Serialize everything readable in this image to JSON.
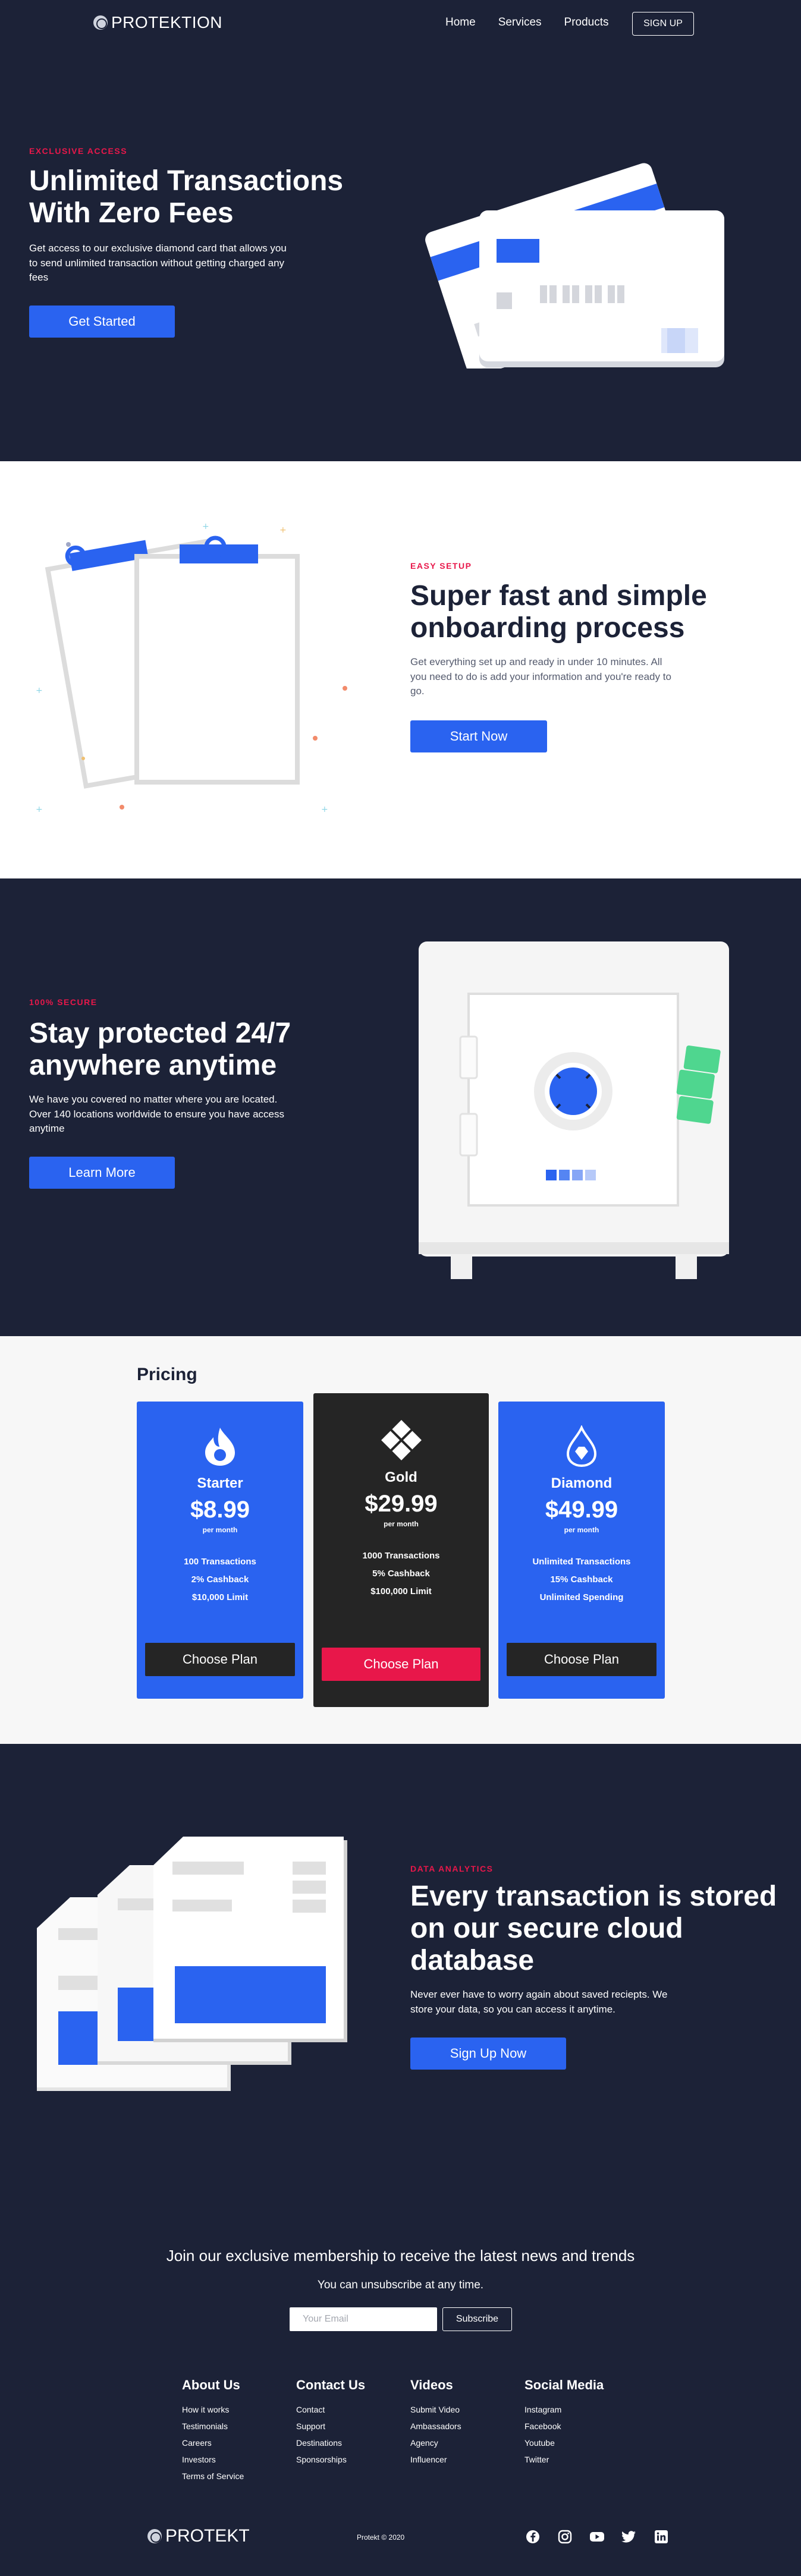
{
  "nav": {
    "brand": "PROTEKTION",
    "links": [
      "Home",
      "Services",
      "Products"
    ],
    "signup": "SIGN UP"
  },
  "hero": {
    "eyebrow": "EXCLUSIVE ACCESS",
    "title_line1": "Unlimited Transactions",
    "title_line2": "With Zero Fees",
    "text": "Get access to our exclusive diamond card that allows you to send unlimited transaction without getting charged any fees",
    "button": "Get Started"
  },
  "onboarding": {
    "eyebrow": "EASY SETUP",
    "title_line1": "Super fast and simple",
    "title_line2": "onboarding process",
    "text": "Get everything set up and ready in under 10 minutes. All you need to do is add your information and you're ready to go.",
    "button": "Start Now"
  },
  "security": {
    "eyebrow": "100% SECURE",
    "title_line1": "Stay protected 24/7",
    "title_line2": "anywhere anytime",
    "text": "We have you covered no matter where you are located. Over 140 locations worldwide to ensure you have access anytime",
    "button": "Learn More"
  },
  "pricing": {
    "title": "Pricing",
    "plans": [
      {
        "name": "Starter",
        "price": "$8.99",
        "period": "per month",
        "features": [
          "100 Transactions",
          "2% Cashback",
          "$10,000 Limit"
        ],
        "button": "Choose Plan",
        "icon": "fire-icon"
      },
      {
        "name": "Gold",
        "price": "$29.99",
        "period": "per month",
        "features": [
          "1000 Transactions",
          "5% Cashback",
          "$100,000 Limit"
        ],
        "button": "Choose Plan",
        "icon": "diamond-grid-icon"
      },
      {
        "name": "Diamond",
        "price": "$49.99",
        "period": "per month",
        "features": [
          "Unlimited Transactions",
          "15% Cashback",
          "Unlimited Spending"
        ],
        "button": "Choose Plan",
        "icon": "gem-drop-icon"
      }
    ]
  },
  "analytics": {
    "eyebrow": "DATA ANALYTICS",
    "title_line1": "Every transaction is stored",
    "title_line2": "on our secure cloud",
    "title_line3": "database",
    "text": "Never ever have to worry again about saved reciepts. We store your data, so you can access it anytime.",
    "button": "Sign Up Now"
  },
  "newsletter": {
    "title": "Join our exclusive membership to receive the latest news and trends",
    "subtitle": "You can unsubscribe at any time.",
    "placeholder": "Your Email",
    "button": "Subscribe"
  },
  "footer": {
    "columns": [
      {
        "title": "About Us",
        "links": [
          "How it works",
          "Testimonials",
          "Careers",
          "Investors",
          "Terms of Service"
        ]
      },
      {
        "title": "Contact Us",
        "links": [
          "Contact",
          "Support",
          "Destinations",
          "Sponsorships"
        ]
      },
      {
        "title": "Videos",
        "links": [
          "Submit Video",
          "Ambassadors",
          "Agency",
          "Influencer"
        ]
      },
      {
        "title": "Social Media",
        "links": [
          "Instagram",
          "Facebook",
          "Youtube",
          "Twitter"
        ]
      }
    ],
    "brand": "PROTEKT",
    "copyright": "Protekt © 2020",
    "social_icons": [
      "facebook-icon",
      "instagram-icon",
      "youtube-icon",
      "twitter-icon",
      "linkedin-icon"
    ]
  },
  "colors": {
    "navy": "#1c2237",
    "blue": "#2a63f0",
    "red": "#e8174a",
    "dark_card": "#252525",
    "green": "#4fd68f"
  }
}
